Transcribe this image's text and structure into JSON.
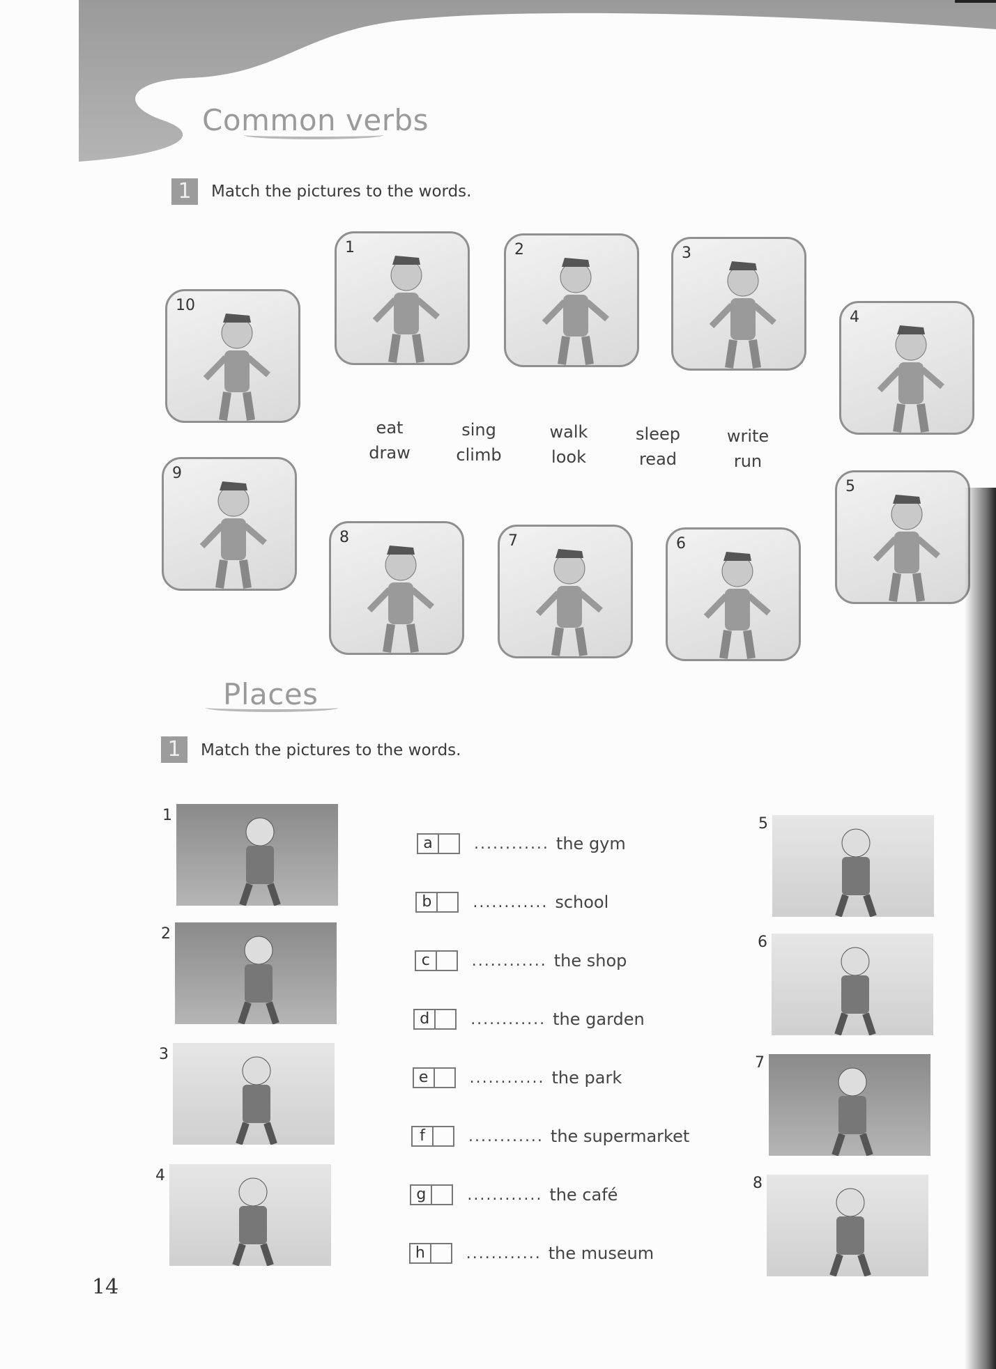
{
  "verbs": {
    "title": "Common verbs",
    "exercise_number": "1",
    "instruction": "Match the pictures to the words.",
    "pictures": [
      "1",
      "2",
      "3",
      "4",
      "5",
      "6",
      "7",
      "8",
      "9",
      "10"
    ],
    "words_row1": [
      "eat",
      "sing",
      "walk",
      "sleep",
      "write"
    ],
    "words_row2": [
      "draw",
      "climb",
      "look",
      "read",
      "run"
    ]
  },
  "places": {
    "title": "Places",
    "exercise_number": "1",
    "instruction": "Match the pictures to the words.",
    "pictures": [
      "1",
      "2",
      "3",
      "4",
      "5",
      "6",
      "7",
      "8"
    ],
    "answers": [
      {
        "letter": "a",
        "dots": "............",
        "text": "the gym"
      },
      {
        "letter": "b",
        "dots": "............",
        "text": "school"
      },
      {
        "letter": "c",
        "dots": "............",
        "text": "the shop"
      },
      {
        "letter": "d",
        "dots": "............",
        "text": "the garden"
      },
      {
        "letter": "e",
        "dots": "............",
        "text": "the park"
      },
      {
        "letter": "f",
        "dots": "............",
        "text": "the supermarket"
      },
      {
        "letter": "g",
        "dots": "............",
        "text": "the café"
      },
      {
        "letter": "h",
        "dots": "............",
        "text": "the museum"
      }
    ]
  },
  "page_number": "14",
  "colors": {
    "header_gray": "#a3a3a3",
    "badge_gray": "#9c9c9c",
    "title_gray": "#9a9a9a"
  }
}
